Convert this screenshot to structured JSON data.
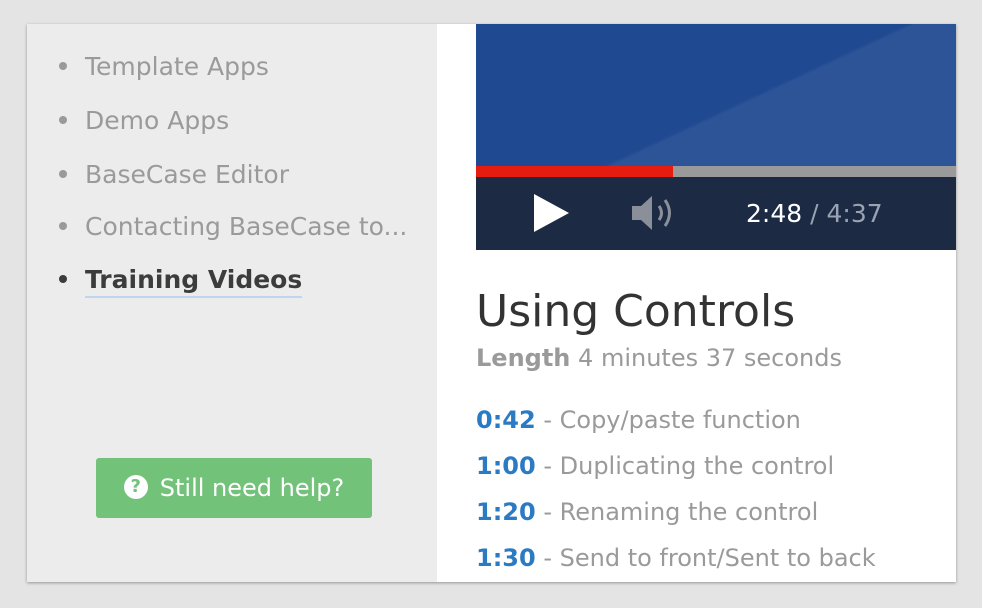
{
  "sidebar": {
    "items": [
      {
        "label": "Template Apps",
        "active": false
      },
      {
        "label": "Demo Apps",
        "active": false
      },
      {
        "label": "BaseCase Editor",
        "active": false
      },
      {
        "label": "Contacting BaseCase to...",
        "active": false
      },
      {
        "label": "Training Videos",
        "active": true
      }
    ],
    "help_button": {
      "label": "Still need help?",
      "icon": "question-circle-icon"
    }
  },
  "video": {
    "current_time": "2:48",
    "separator": "/",
    "total_time": "4:37",
    "progress_fraction": 0.41,
    "play_icon": "play-icon",
    "volume_icon": "volume-icon"
  },
  "content": {
    "title": "Using Controls",
    "length_label": "Length",
    "length_value": "4 minutes 37 seconds",
    "chapters": [
      {
        "time": "0:42",
        "text": "- Copy/paste function"
      },
      {
        "time": "1:00",
        "text": "- Duplicating the control"
      },
      {
        "time": "1:20",
        "text": "- Renaming the control"
      },
      {
        "time": "1:30",
        "text": "- Send to front/Sent to back"
      }
    ]
  },
  "colors": {
    "accent_blue": "#2b7bc4",
    "help_green": "#72c27a",
    "video_blue": "#1f4991",
    "progress_red": "#e51c0f"
  }
}
